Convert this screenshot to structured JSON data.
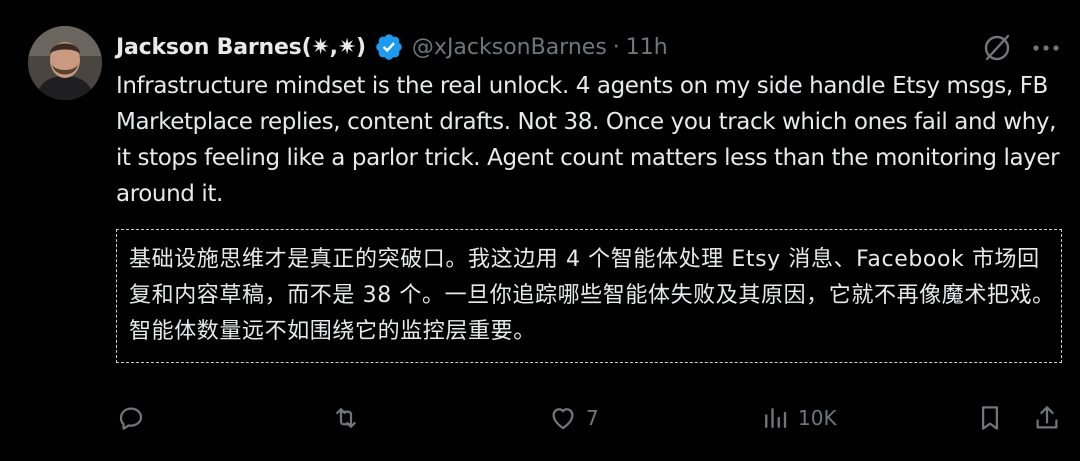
{
  "post": {
    "author": {
      "display_name": "Jackson Barnes(✷,✷)",
      "handle": "@xJacksonBarnes",
      "separator": "·",
      "time": "11h"
    },
    "text": "Infrastructure mindset is the real unlock. 4 agents on my side handle Etsy msgs, FB Marketplace replies, content drafts. Not 38. Once you track which ones fail and why, it stops feeling like a parlor trick. Agent count matters less than the monitoring layer around it.",
    "translation": "基础设施思维才是真正的突破口。我这边用 4 个智能体处理 Etsy 消息、Facebook 市场回复和内容草稿，而不是 38 个。一旦你追踪哪些智能体失败及其原因，它就不再像魔术把戏。智能体数量远不如围绕它的监控层重要。"
  },
  "actions": {
    "reply": {
      "icon": "reply-icon"
    },
    "repost": {
      "icon": "repost-icon"
    },
    "like": {
      "icon": "heart-icon",
      "count": "7"
    },
    "views": {
      "icon": "views-icon",
      "count": "10K"
    },
    "bookmark": {
      "icon": "bookmark-icon"
    },
    "share": {
      "icon": "share-icon"
    }
  },
  "colors": {
    "background": "#000000",
    "text": "#e7e9ea",
    "secondary": "#71767b",
    "verified": "#1d9bf0"
  }
}
